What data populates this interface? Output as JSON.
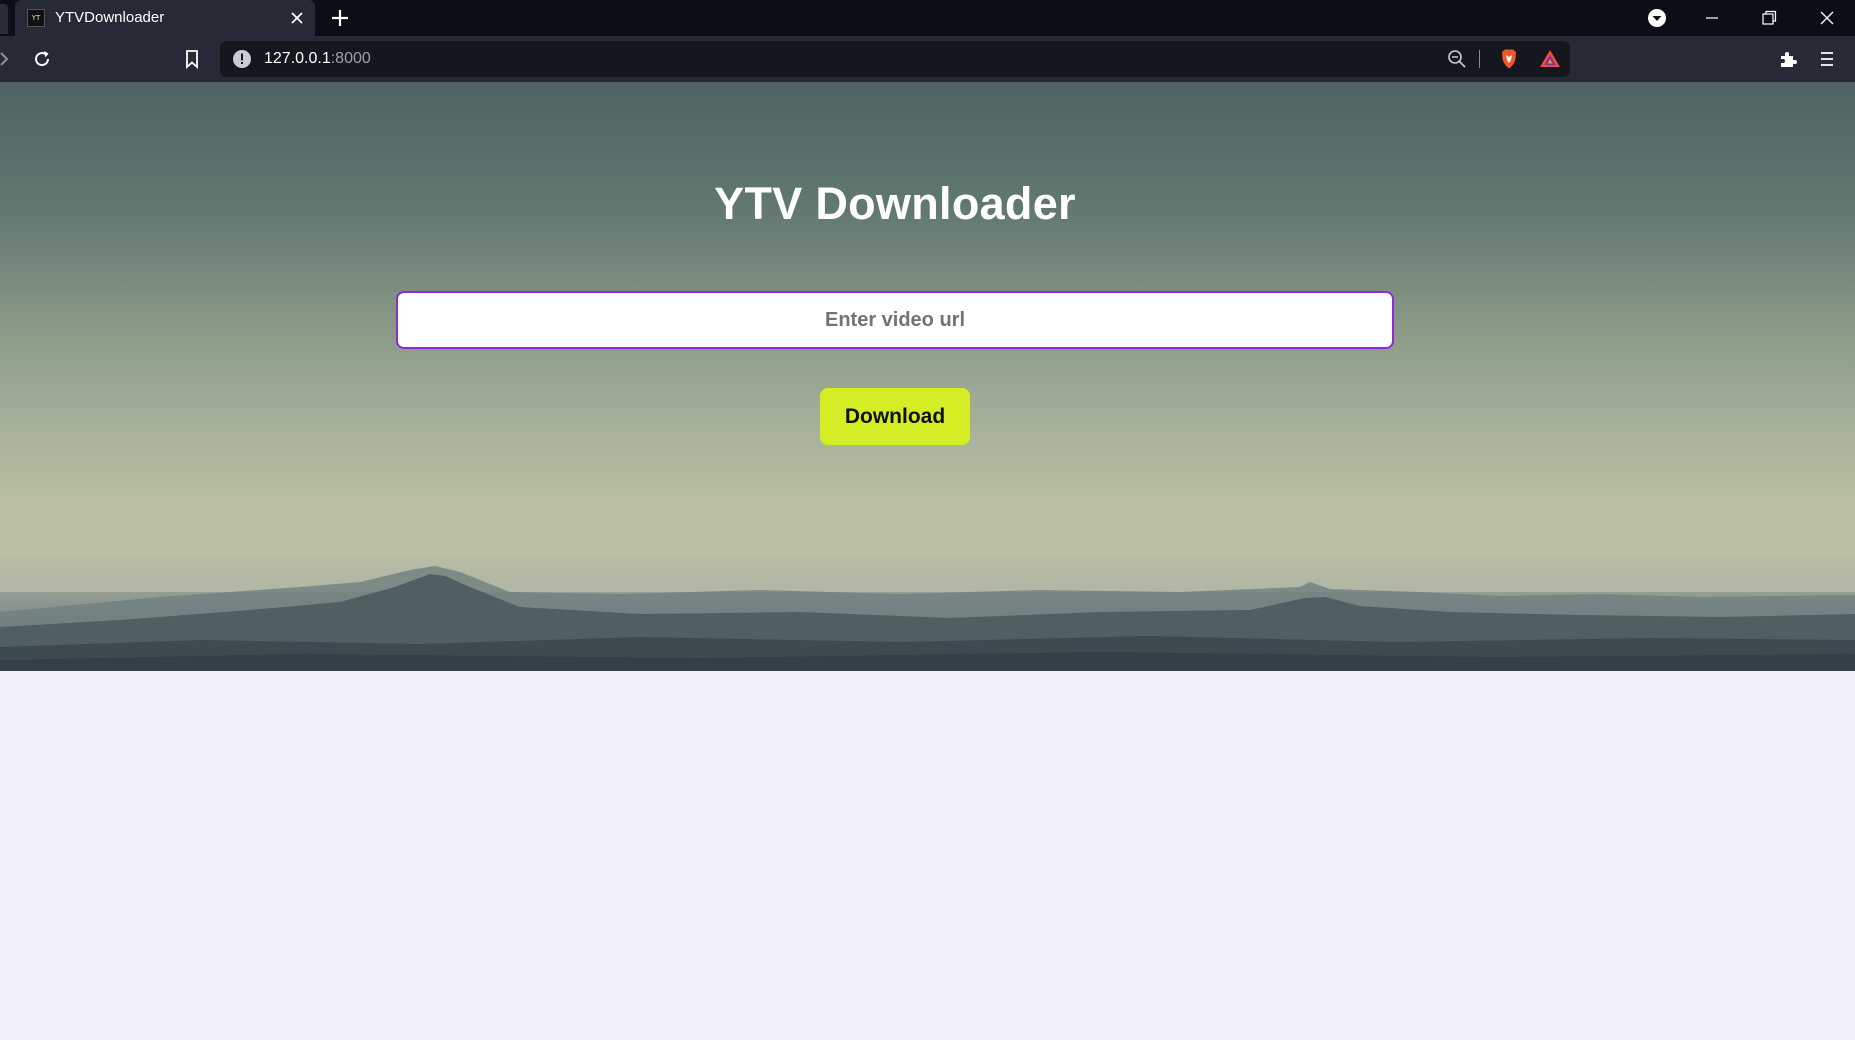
{
  "browser": {
    "tab": {
      "favicon_text": "YT",
      "title": "YTVDownloader"
    },
    "address": {
      "host": "127.0.0.1",
      "port": ":8000"
    }
  },
  "page": {
    "title": "YTV Downloader",
    "url_input": {
      "value": "",
      "placeholder": "Enter video url"
    },
    "download_label": "Download"
  },
  "colors": {
    "accent_border": "#8e2ad6",
    "button_bg": "#d5ed24",
    "page_bg": "#f0f1f8",
    "chrome_bg": "#262a36",
    "tabbar_bg": "#0b0d17"
  },
  "icons": [
    "close-icon",
    "plus-icon",
    "download-indicator-icon",
    "minimize-icon",
    "restore-icon",
    "window-close-icon",
    "forward-icon",
    "reload-icon",
    "bookmark-icon",
    "info-icon",
    "zoom-out-icon",
    "brave-shields-icon",
    "brave-rewards-icon",
    "extensions-icon",
    "menu-icon"
  ]
}
